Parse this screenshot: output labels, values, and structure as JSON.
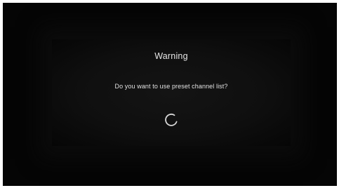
{
  "dialog": {
    "title": "Warning",
    "message": "Do you want to use preset channel list?",
    "spinner_icon": "loading-spinner-icon"
  },
  "colors": {
    "screen_background": "#050505",
    "dialog_background": "#121212",
    "text": "#e6e6e6",
    "spinner": "#d8d8d8"
  }
}
